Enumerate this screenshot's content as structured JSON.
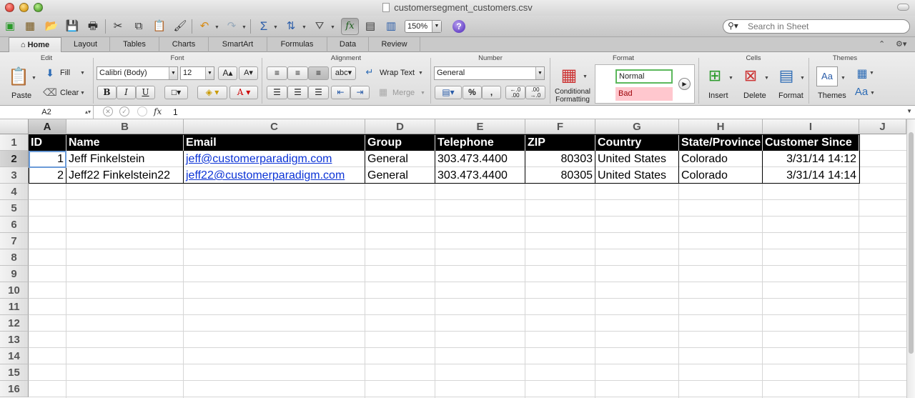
{
  "window": {
    "title": "customersegment_customers.csv"
  },
  "toolbar": {
    "zoom": "150%",
    "help": "?",
    "fx": "fx",
    "search_placeholder": "Search in Sheet"
  },
  "tabs": [
    "Home",
    "Layout",
    "Tables",
    "Charts",
    "SmartArt",
    "Formulas",
    "Data",
    "Review"
  ],
  "ribbon": {
    "groups": {
      "edit": "Edit",
      "font": "Font",
      "alignment": "Alignment",
      "number": "Number",
      "format": "Format",
      "cells": "Cells",
      "themes": "Themes"
    },
    "edit": {
      "paste": "Paste",
      "fill": "Fill",
      "clear": "Clear"
    },
    "font": {
      "name": "Calibri (Body)",
      "size": "12",
      "grow": "A",
      "shrink": "A",
      "bold": "B",
      "italic": "I",
      "underline": "U",
      "color_letter": "A"
    },
    "alignment": {
      "wrap_text": "Wrap Text",
      "merge": "Merge",
      "orientation": "abc"
    },
    "number": {
      "format": "General",
      "percent": "%",
      "comma": ",",
      "inc_decimal": "←.0\n.00",
      "dec_decimal": ".00\n→.0"
    },
    "format": {
      "conditional": "Conditional Formatting",
      "normal": "Normal",
      "bad": "Bad"
    },
    "cells": {
      "insert": "Insert",
      "delete": "Delete",
      "format": "Format"
    },
    "themes": {
      "themes": "Themes",
      "fonts": "Aa"
    }
  },
  "formula_bar": {
    "cell_ref": "A2",
    "value": "1",
    "fx": "fx"
  },
  "sheet": {
    "columns": [
      "A",
      "B",
      "C",
      "D",
      "E",
      "F",
      "G",
      "H",
      "I",
      "J"
    ],
    "rows": [
      "1",
      "2",
      "3",
      "4",
      "5",
      "6",
      "7",
      "8",
      "9",
      "10",
      "11",
      "12",
      "13",
      "14",
      "15",
      "16"
    ],
    "header": [
      "ID",
      "Name",
      "Email",
      "Group",
      "Telephone",
      "ZIP",
      "Country",
      "State/Province",
      "Customer Since"
    ],
    "data": [
      [
        "1",
        "Jeff Finkelstein",
        "jeff@customerparadigm.com",
        "General",
        "303.473.4400",
        "80303",
        "United States",
        "Colorado",
        "3/31/14 14:12"
      ],
      [
        "2",
        "Jeff22 Finkelstein22",
        "jeff22@customerparadigm.com",
        "General",
        "303.473.4400",
        "80305",
        "United States",
        "Colorado",
        "3/31/14 14:14"
      ]
    ]
  },
  "colors": {
    "link": "#0b33d6",
    "header_bg": "#000000",
    "selection": "#6b9bd8",
    "bad_bg": "#ffc7ce",
    "bad_fg": "#9c0006",
    "normal_border": "#5cb85c"
  }
}
